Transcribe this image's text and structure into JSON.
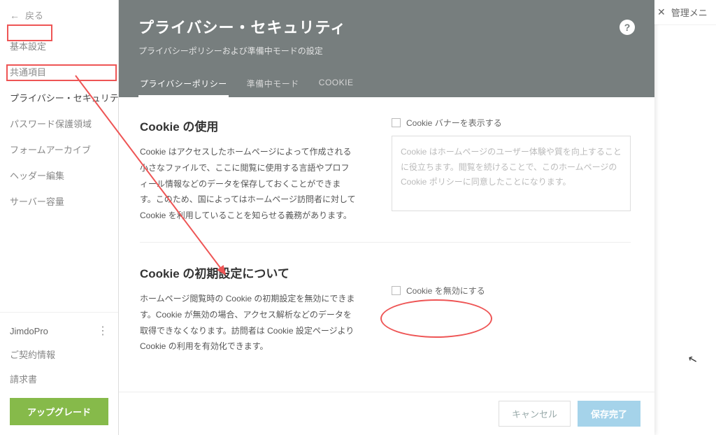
{
  "sidebar": {
    "back_label": "戻る",
    "nav": [
      {
        "label": "基本設定"
      },
      {
        "label": "共通項目"
      },
      {
        "label": "プライバシー・セキュリティ"
      },
      {
        "label": "パスワード保護領域"
      },
      {
        "label": "フォームアーカイブ"
      },
      {
        "label": "ヘッダー編集"
      },
      {
        "label": "サーバー容量"
      }
    ],
    "plan_name": "JimdoPro",
    "bottom_links": [
      {
        "label": "ご契約情報"
      },
      {
        "label": "請求書"
      }
    ],
    "upgrade_label": "アップグレード"
  },
  "header": {
    "title": "プライバシー・セキュリティ",
    "subtitle": "プライバシーポリシーおよび準備中モードの設定",
    "help_symbol": "?"
  },
  "tabs": [
    {
      "label": "プライバシーポリシー",
      "active": true
    },
    {
      "label": "準備中モード",
      "active": false
    },
    {
      "label": "COOKIE",
      "active": false
    }
  ],
  "sections": {
    "cookie_use": {
      "title": "Cookie の使用",
      "desc": "Cookie はアクセスしたホームページによって作成される小さなファイルで、ここに閲覧に使用する言語やプロフィール情報などのデータを保存しておくことができます。このため、国によってはホームページ訪問者に対して Cookie を利用していることを知らせる義務があります。",
      "checkbox_label": "Cookie バナーを表示する",
      "placeholder_text": "Cookie はホームページのユーザー体験や質を向上することに役立ちます。閲覧を続けることで、このホームページの Cookie ポリシーに同意したことになります。"
    },
    "cookie_default": {
      "title": "Cookie の初期設定について",
      "desc": "ホームページ閲覧時の Cookie の初期設定を無効にできます。Cookie が無効の場合、アクセス解析などのデータを取得できなくなります。訪問者は Cookie 設定ページより Cookie の利用を有効化できます。",
      "checkbox_label": "Cookie を無効にする"
    }
  },
  "footer": {
    "cancel_label": "キャンセル",
    "save_label": "保存完了"
  },
  "right_panel": {
    "label": "管理メニ"
  }
}
